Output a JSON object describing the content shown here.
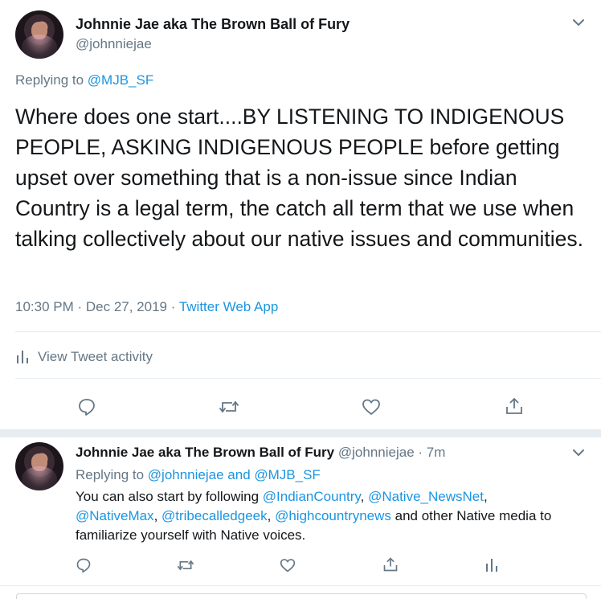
{
  "main_tweet": {
    "display_name": "Johnnie Jae aka The Brown Ball of Fury",
    "handle": "@johnniejae",
    "replying_prefix": "Replying to ",
    "replying_to": "@MJB_SF",
    "text": "Where does one start....BY LISTENING TO INDIGENOUS PEOPLE, ASKING INDIGENOUS PEOPLE before getting upset over something that is a non-issue since Indian Country is a legal term, the catch all term that we use when talking collectively about our native issues and communities.",
    "time": "10:30 PM",
    "date": "Dec 27, 2019",
    "sep": " · ",
    "source": "Twitter Web App",
    "activity_label": "View Tweet activity"
  },
  "reply_tweet": {
    "display_name": "Johnnie Jae aka The Brown Ball of Fury",
    "handle": "@johnniejae",
    "age": "7m",
    "sep": " · ",
    "replying_prefix": "Replying to ",
    "replying_user1": "@johnniejae",
    "replying_and": " and ",
    "replying_user2": "@MJB_SF",
    "text_part1": "You can also start by following ",
    "mention1": "@IndianCountry",
    "comma1": ", ",
    "mention2": "@Native_NewsNet",
    "comma2": ",",
    "mention3": "@NativeMax",
    "comma3": ", ",
    "mention4": "@tribecalledgeek",
    "comma4": ", ",
    "mention5": "@highcountrynews",
    "text_part2": " and other Native media to familiarize yourself with Native voices."
  },
  "icons": [
    "chevron-down-icon",
    "bar-chart-icon",
    "reply-icon",
    "retweet-icon",
    "like-icon",
    "share-icon"
  ],
  "colors": {
    "link": "#1b95e0",
    "secondary": "#657786",
    "text": "#14171a",
    "divider": "#e6ecf0"
  }
}
